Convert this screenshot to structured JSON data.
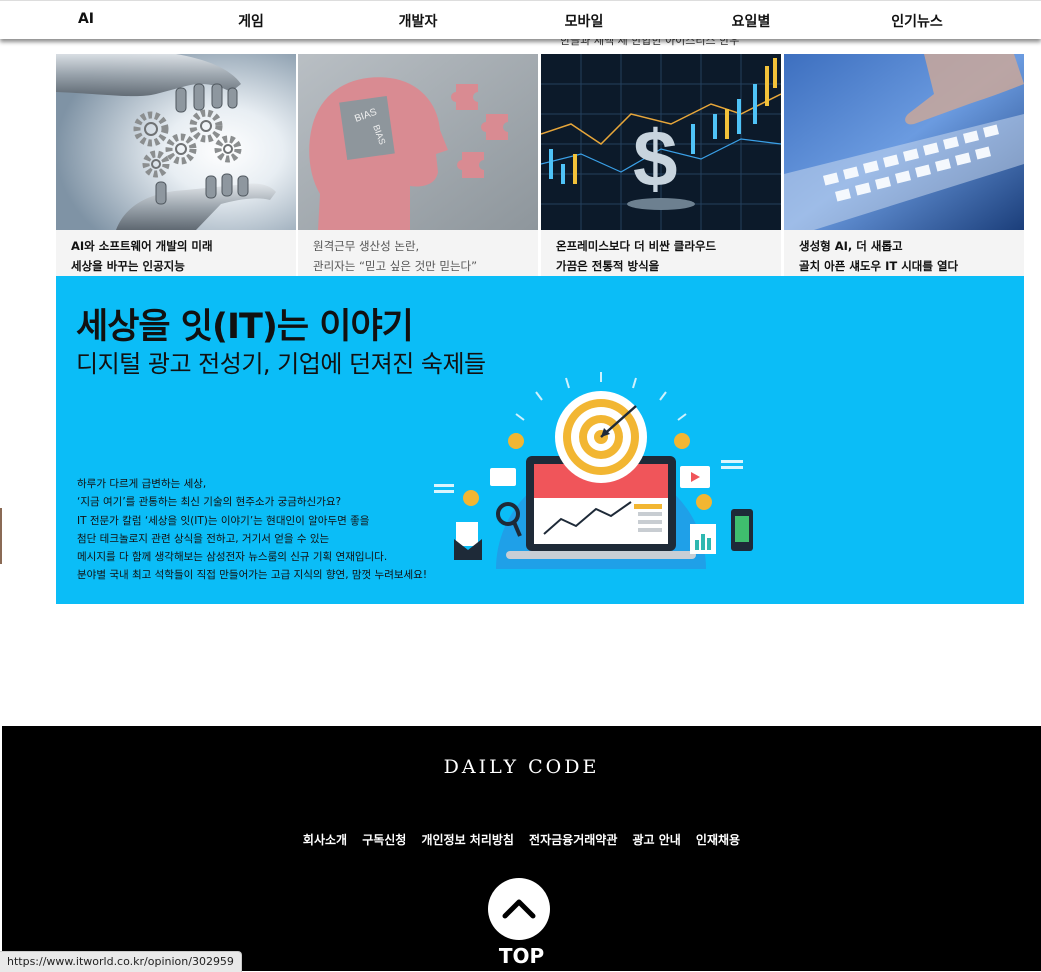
{
  "nav": {
    "items": [
      "AI",
      "게임",
      "개발자",
      "모바일",
      "요일별",
      "인기뉴스"
    ]
  },
  "peek_text": "한글과 세액 세 한합한 아이스티스 한우",
  "cards": [
    {
      "line1": "AI와 소프트웨어 개발의 미래",
      "line2": "세상을 바꾸는 인공지능"
    },
    {
      "line1": "원격근무 생산성 논란,",
      "line2": "관리자는 “믿고 싶은 것만 믿는다”"
    },
    {
      "line1": "온프레미스보다 더 비싼 클라우드",
      "line2": "가끔은 전통적 방식을"
    },
    {
      "line1": "생성형 AI, 더 새롭고",
      "line2": "골치 아픈 섀도우 IT 시대를 열다"
    }
  ],
  "card2_image_text": {
    "bias": "BIAS",
    "bias_rotated": "BIAS"
  },
  "banner": {
    "title": "세상을 잇(IT)는 이야기",
    "subtitle": "디지털 광고 전성기, 기업에 던져진 숙제들",
    "desc": [
      "하루가 다르게 급변하는 세상,",
      "‘지금 여기’를 관통하는 최신 기술의 현주소가 궁금하신가요?",
      "IT 전문가 칼럼 ‘세상을 잇(IT)는 이야기’는 현대인이 알아두면 좋을",
      "첨단 테크놀로지 관련 상식을 전하고, 거기서 얻을 수 있는",
      "메시지를 다 함께 생각해보는 삼성전자 뉴스룸의 신규 기획 연재입니다.",
      "분야별 국내 최고 석학들이 직접 만들어가는 고급 지식의 향연, 맘껏 누려보세요!"
    ]
  },
  "footer": {
    "brand": "DAILY CODE",
    "links": [
      "회사소개",
      "구독신청",
      "개인정보 처리방침",
      "전자금융거래약관",
      "광고 안내",
      "인재채용"
    ],
    "top_label": "TOP"
  },
  "status_url": "https://www.itworld.co.kr/opinion/302959",
  "colors": {
    "banner_bg": "#0bbdf7",
    "footer_bg": "#000000",
    "card_bg": "#f4f4f4"
  }
}
